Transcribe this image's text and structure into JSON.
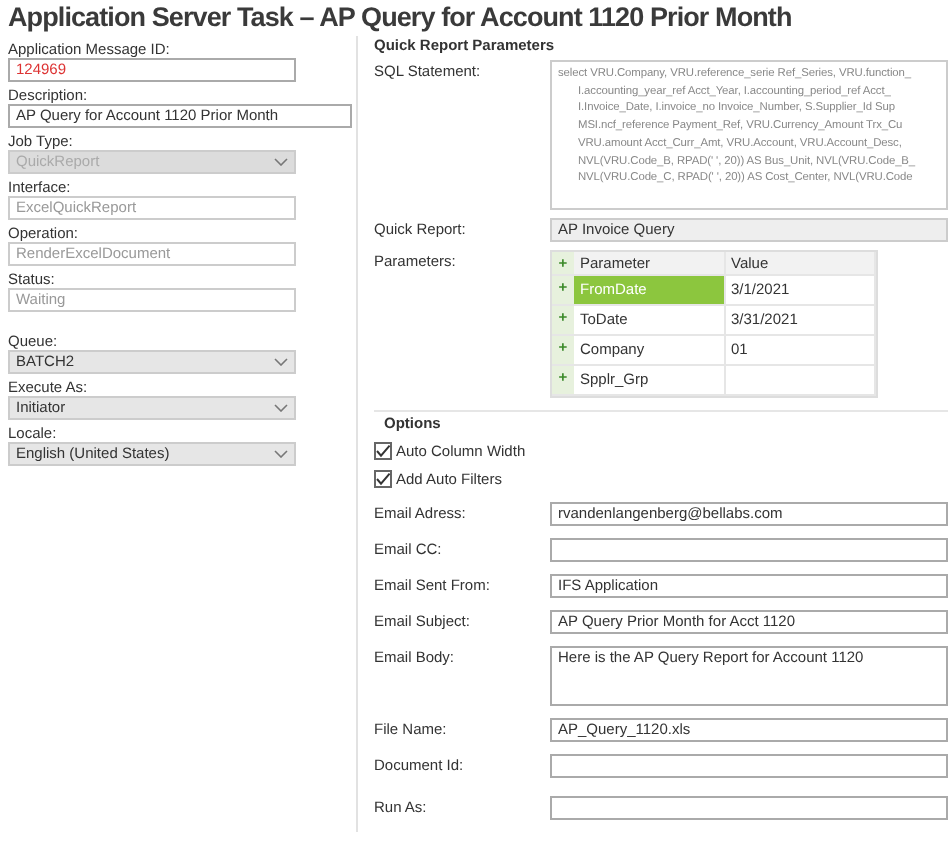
{
  "window": {
    "title": "Application Server Task – AP Query for Account 1120 Prior Month"
  },
  "left_fields": [
    {
      "label": "Application Message ID:",
      "value": "124969",
      "kind": "id",
      "disabled": false
    },
    {
      "label": "Description:",
      "value": "AP Query for Account 1120 Prior Month",
      "kind": "wide",
      "disabled": false
    },
    {
      "label": "Job Type:",
      "value": "QuickReport",
      "kind": "combo",
      "disabled": true
    },
    {
      "label": "Interface:",
      "value": "ExcelQuickReport",
      "kind": "text",
      "disabled": true
    },
    {
      "label": "Operation:",
      "value": "RenderExcelDocument",
      "kind": "text",
      "disabled": true
    },
    {
      "label": "Status:",
      "value": "Waiting",
      "kind": "text",
      "disabled": true
    },
    {
      "label": "Queue:",
      "value": "BATCH2",
      "kind": "combo",
      "disabled": false
    },
    {
      "label": "Execute As:",
      "value": "Initiator",
      "kind": "combo",
      "disabled": false
    },
    {
      "label": "Locale:",
      "value": "English (United States)",
      "kind": "combo",
      "disabled": false
    }
  ],
  "quick_report_parameters": {
    "heading": "Quick Report Parameters",
    "sql_label": "SQL Statement:",
    "sql_lines": [
      "select VRU.Company, VRU.reference_serie Ref_Series, VRU.function_",
      "I.accounting_year_ref Acct_Year, I.accounting_period_ref Acct_",
      "I.Invoice_Date, I.invoice_no Invoice_Number, S.Supplier_Id Sup",
      "MSI.ncf_reference Payment_Ref, VRU.Currency_Amount Trx_Cu",
      "VRU.amount Acct_Curr_Amt, VRU.Account, VRU.Account_Desc,",
      "NVL(VRU.Code_B, RPAD(' ', 20)) AS Bus_Unit, NVL(VRU.Code_B_",
      "NVL(VRU.Code_C, RPAD(' ', 20)) AS Cost_Center, NVL(VRU.Code"
    ],
    "quick_report_label": "Quick Report:",
    "quick_report": "AP Invoice Query",
    "parameters_label": "Parameters:",
    "table": {
      "add": "+",
      "columns": [
        "Parameter",
        "Value"
      ],
      "rows": [
        {
          "marker": "+",
          "parameter": "FromDate",
          "value": "3/1/2021",
          "selected": true
        },
        {
          "marker": "+",
          "parameter": "ToDate",
          "value": "3/31/2021",
          "selected": false
        },
        {
          "marker": "+",
          "parameter": "Company",
          "value": "01",
          "selected": false
        },
        {
          "marker": "+",
          "parameter": "Spplr_Grp",
          "selected": false
        }
      ]
    }
  },
  "options": {
    "heading": "Options",
    "checkboxes": [
      {
        "label": "Auto Column Width",
        "checked": true
      },
      {
        "label": "Add Auto Filters",
        "checked": true
      }
    ],
    "fields": [
      {
        "label": "Email Adress:",
        "value": "rvandenlangenberg@bellabs.com",
        "kind": "text"
      },
      {
        "label": "Email CC:",
        "kind": "text"
      },
      {
        "label": "Email Sent From:",
        "value": "IFS Application",
        "kind": "text"
      },
      {
        "label": "Email Subject:",
        "value": "AP Query Prior Month for Acct 1120",
        "kind": "text"
      },
      {
        "label": "Email Body:",
        "value": "Here is the AP Query Report for Account 1120",
        "kind": "area"
      },
      {
        "label": "File Name:",
        "value": "AP_Query_1120.xls",
        "kind": "text"
      },
      {
        "label": "Document Id:",
        "kind": "text"
      },
      {
        "label": "Run As:",
        "kind": "gap"
      }
    ]
  }
}
